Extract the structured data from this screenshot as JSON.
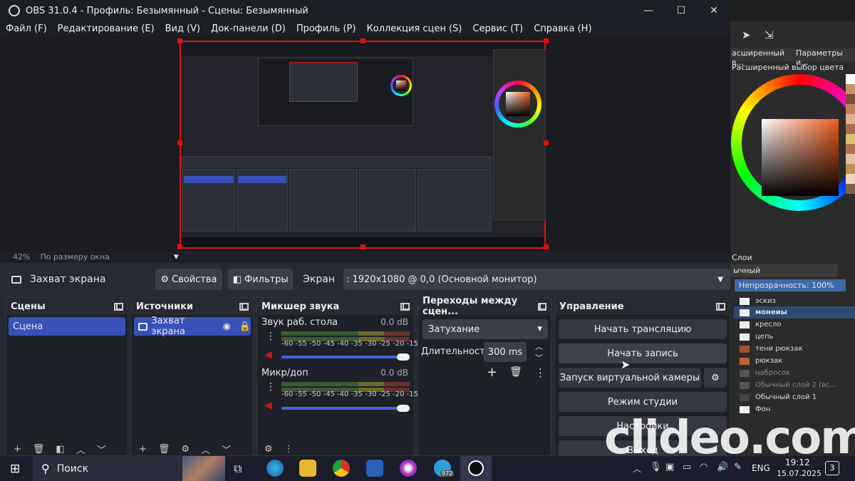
{
  "window": {
    "title": "OBS 31.0.4 - Профиль: Безымянный - Сцены: Безымянный",
    "minimize": "—",
    "maximize": "☐",
    "close": "✕"
  },
  "menu": [
    "Файл (F)",
    "Редактирование (E)",
    "Вид (V)",
    "Док-панели (D)",
    "Профиль (P)",
    "Коллекция сцен (S)",
    "Сервис (T)",
    "Справка (H)"
  ],
  "status": {
    "zoom": "42%",
    "fit": "По размеру окна",
    "arrow": "▼"
  },
  "source_bar": {
    "source_name": "Захват экрана",
    "properties": "Свойства",
    "filters": "Фильтры",
    "screen_label": "Экран",
    "screen_value": ": 1920x1080 @ 0,0 (Основной монитор)",
    "dropdown": "▼"
  },
  "scenes": {
    "title": "Сцены",
    "items": [
      "Сцена"
    ]
  },
  "sources": {
    "title": "Источники",
    "items": [
      "Захват экрана"
    ]
  },
  "mixer": {
    "title": "Микшер звука",
    "scale": "-60 -55 -50 -45 -40 -35 -30 -25 -20 -15 -10  -5   0",
    "channels": [
      {
        "name": "Звук раб. стола",
        "db": "0.0 dB",
        "level": 0.95
      },
      {
        "name": "Микр/доп",
        "db": "0.0 dB",
        "level": 0.95
      }
    ]
  },
  "transitions": {
    "title": "Переходы между сцен...",
    "type": "Затухание",
    "duration_label": "Длительность",
    "duration_value": "300 ms"
  },
  "controls": {
    "title": "Управление",
    "start_stream": "Начать трансляцию",
    "start_record": "Начать запись",
    "virtual_cam": "Запуск виртуальной камеры",
    "studio_mode": "Режим студии",
    "settings": "Настройки",
    "exit": "Выход"
  },
  "krita": {
    "tab1": "асширенный в...",
    "tab2": "Параметры и...",
    "color_panel": "Расширенный выбор цвета",
    "layers_title": "Слои",
    "blend": "ычный",
    "opacity": "Непрозрачность: 100%",
    "layers": [
      "эскиз",
      "монеиы",
      "кресло",
      "цепь",
      "тени рюкзак",
      "рюкзак",
      "набросок",
      "Обычный слой 2 (вс...",
      "Обычный слой 1",
      "Фон"
    ]
  },
  "taskbar": {
    "search": "Поиск",
    "lang": "ENG",
    "time": "19:12",
    "date": "15.07.2025",
    "notif": "3",
    "tg_badge": "972"
  },
  "watermark": "clideo.com",
  "colors": {
    "accent": "#3751b8",
    "record_red": "#e01010"
  }
}
